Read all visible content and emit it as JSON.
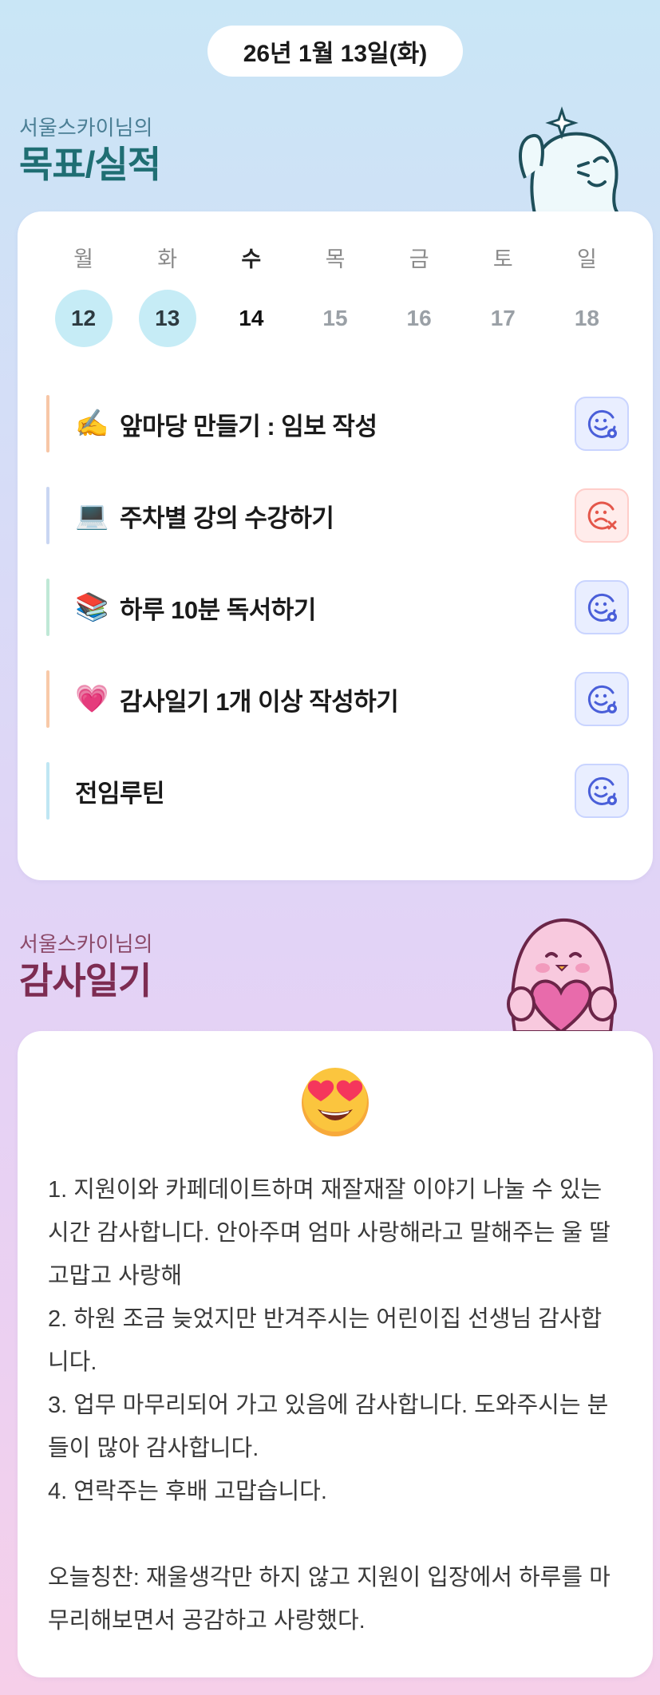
{
  "date": "26년 1월 13일(화)",
  "goals_section": {
    "subtitle": "서울스카이님의",
    "title": "목표/실적"
  },
  "week": [
    {
      "day": "월",
      "num": "12",
      "state": "done"
    },
    {
      "day": "화",
      "num": "13",
      "state": "done"
    },
    {
      "day": "수",
      "num": "14",
      "state": "today"
    },
    {
      "day": "목",
      "num": "15",
      "state": "future"
    },
    {
      "day": "금",
      "num": "16",
      "state": "future"
    },
    {
      "day": "토",
      "num": "17",
      "state": "future"
    },
    {
      "day": "일",
      "num": "18",
      "state": "future"
    }
  ],
  "goals": [
    {
      "emoji": "✍️",
      "label": "앞마당 만들기 : 임보 작성",
      "status": "achieved",
      "bar_color": "#f7c6a6"
    },
    {
      "emoji": "💻",
      "label": "주차별 강의 수강하기",
      "status": "missed",
      "bar_color": "#c9d6f2"
    },
    {
      "emoji": "📚",
      "label": "하루 10분 독서하기",
      "status": "achieved",
      "bar_color": "#bfe8d6"
    },
    {
      "emoji": "💗",
      "label": "감사일기 1개 이상 작성하기",
      "status": "achieved",
      "bar_color": "#f8c9a8"
    },
    {
      "emoji": "",
      "label": "전임루틴",
      "status": "achieved",
      "bar_color": "#bfe6f3"
    }
  ],
  "diary_section": {
    "subtitle": "서울스카이님의",
    "title": "감사일기"
  },
  "diary": {
    "emoji": "heart-eyes-face",
    "text": "1. 지원이와 카페데이트하며 재잘재잘 이야기 나눌 수 있는 시간 감사합니다. 안아주며 엄마 사랑해라고 말해주는 울 딸 고맙고 사랑해\n2. 하원 조금 늦었지만 반겨주시는 어린이집 선생님 감사합니다.\n3. 업무 마무리되어 가고 있음에 감사합니다. 도와주시는 분들이 많아 감사합니다.\n4. 연락주는 후배 고맙습니다.\n\n오늘칭찬: 재울생각만 하지 않고 지원이 입장에서 하루를 마무리해보면서 공감하고 사랑했다."
  },
  "colors": {
    "goals_title": "#1f6e73",
    "diary_title": "#7d2c52",
    "done_day": "#c6ecf6",
    "achieved_icon": "#4a5fd9",
    "missed_icon": "#e4574b"
  }
}
